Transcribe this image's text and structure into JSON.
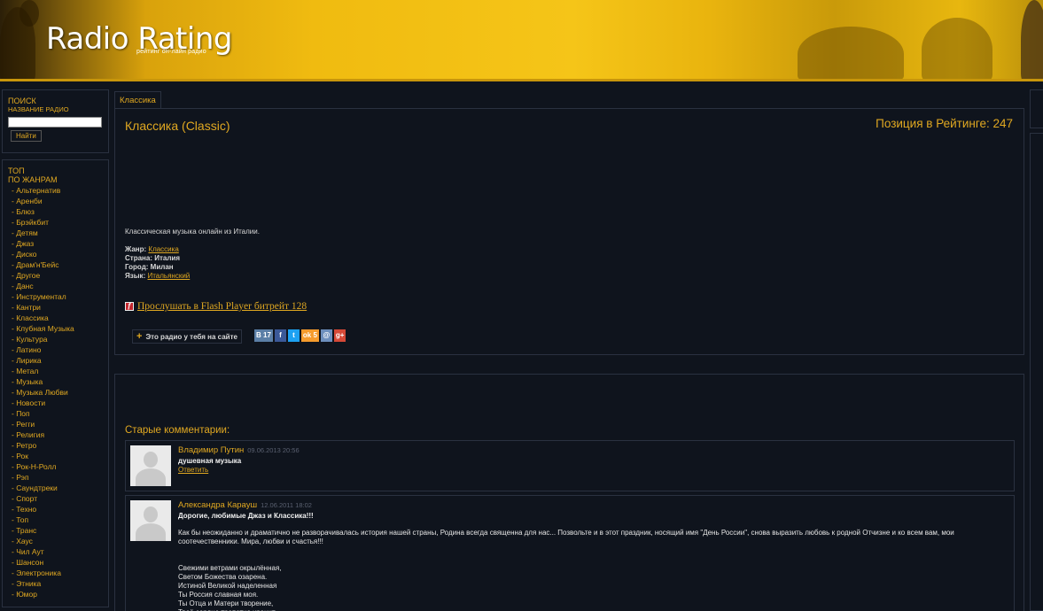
{
  "header": {
    "logo": "Radio Rating",
    "slogan": "рейтинг он-лайн радио"
  },
  "search": {
    "title": "ПОИСК",
    "subtitle": "НАЗВАНИЕ РАДИО",
    "input_value": "",
    "button_label": "Найти"
  },
  "genres": {
    "title": "ТОП",
    "subtitle": "ПО ЖАНРАМ",
    "items": [
      "- Альтернатив",
      "- Аренби",
      "- Блюз",
      "- Брэйкбит",
      "- Детям",
      "- Джаз",
      "- Диско",
      "- Драм'н'Бейс",
      "- Другое",
      "- Данс",
      "- Инструментал",
      "- Кантри",
      "- Классика",
      "- Клубная Музыка",
      "- Культура",
      "- Латино",
      "- Лирика",
      "- Метал",
      "- Музыка",
      "- Музыка Любви",
      "- Новости",
      "- Поп",
      "- Регги",
      "- Религия",
      "- Ретро",
      "- Рок",
      "- Рок-Н-Ролл",
      "- Рэп",
      "- Саундтреки",
      "- Спорт",
      "- Техно",
      "- Топ",
      "- Транс",
      "- Хаус",
      "- Чил Аут",
      "- Шансон",
      "- Электроника",
      "- Этника",
      "- Юмор"
    ]
  },
  "tab": {
    "label": "Классика"
  },
  "station": {
    "title": "Классика (Classic)",
    "rank": "Позиция в Рейтинге: 247",
    "description": "Классическая музыка онлайн из Италии.",
    "genre_label": "Жанр:",
    "genre_value": "Классика",
    "country_label": "Страна:",
    "country_value": "Италия",
    "city_label": "Город:",
    "city_value": "Милан",
    "language_label": "Язык:",
    "language_value": "Итальянский",
    "listen_link": "Прослушать в Flash Player битрейт 128",
    "embed_button": "Это радио у тебя на сайте"
  },
  "share": {
    "vk_count": "17",
    "ok_count": "5"
  },
  "comments": {
    "title": "Старые комментарии:",
    "items": [
      {
        "author": "Владимир Путин",
        "date": "09.06.2013 20:56",
        "text": "душевная музыка",
        "reply": "Ответить"
      },
      {
        "author": "Александра Карауш",
        "date": "12.06.2011 18:02",
        "text": "Дорогие, любимые Джаз и Классика!!!",
        "body": "Как бы неожиданно и драматично не разворачивалась история нашей страны, Родина всегда священна для нас... Позвольте и в этот праздник, носящий имя \"День России\", снова выразить любовь к родной Отчизне и ко всем вам, мои соотечественники. Мира, любви и счастья!!!",
        "poem": [
          "Свежими ветрами окрылённая,",
          "Светом Божества озарена.",
          "Истиной Великой наделенная",
          "Ты Россия славная моя.",
          "Ты Отца и Матери творение,",
          "Твоё сердце трепетно хранит"
        ]
      }
    ]
  },
  "colors": {
    "accent": "#e0a821",
    "background": "#0f141d",
    "border": "#2a3140"
  }
}
